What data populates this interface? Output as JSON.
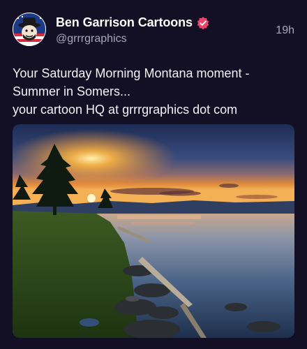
{
  "post": {
    "author": {
      "display_name": "Ben Garrison Cartoons",
      "handle": "@grrrgraphics",
      "avatar_icon": "cartoon-avatar-icon",
      "verified_icon": "verified-badge-icon",
      "verified_color": "#e8476a"
    },
    "timestamp": "19h",
    "text_lines": [
      "Your Saturday Morning Montana moment -",
      "Summer in Somers...",
      "your cartoon HQ at grrrgraphics dot com"
    ],
    "media": {
      "type": "photo",
      "subject": "sunset over lake with pine trees and rocky shoreline"
    }
  },
  "theme": {
    "background": "#130f24",
    "text": "#f4f3f8",
    "muted": "#a9a6b8"
  }
}
